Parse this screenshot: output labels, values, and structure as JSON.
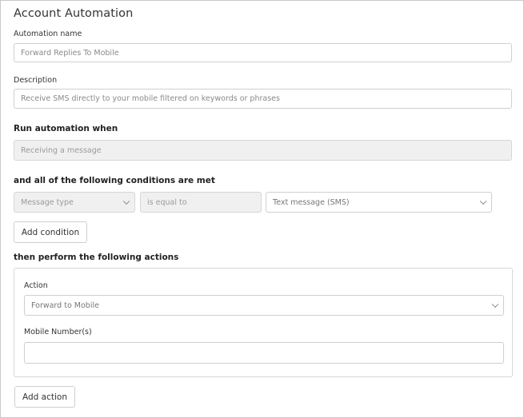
{
  "page": {
    "title": "Account Automation"
  },
  "automation_name": {
    "label": "Automation name",
    "value": "Forward Replies To Mobile"
  },
  "description": {
    "label": "Description",
    "value": "Receive SMS directly to your mobile filtered on keywords or phrases"
  },
  "trigger": {
    "heading": "Run automation when",
    "value": "Receiving a message"
  },
  "conditions": {
    "heading": "and all of the following conditions are met",
    "field": "Message type",
    "operator": "is equal to",
    "value": "Text message (SMS)",
    "add_label": "Add condition"
  },
  "actions": {
    "heading": "then perform the following actions",
    "action_label": "Action",
    "action_value": "Forward to Mobile",
    "mobile_label": "Mobile Number(s)",
    "mobile_value": "",
    "add_label": "Add action"
  },
  "icons": {
    "dropdown": "chevron-down-icon"
  }
}
